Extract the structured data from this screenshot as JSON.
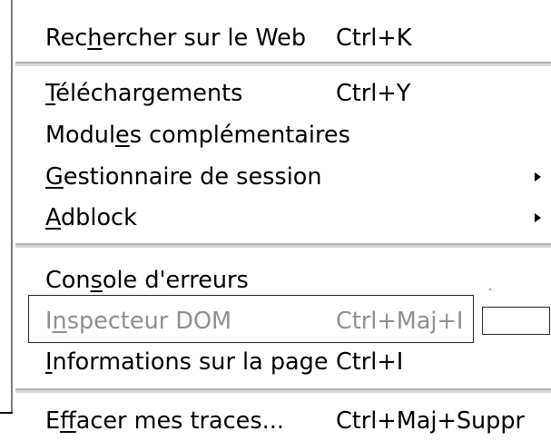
{
  "colors": {
    "background": "#ffffff",
    "text": "#000000",
    "disabled_text": "#8f8f8f",
    "separator": "#d6d6d6",
    "border": "#7a7a7a"
  },
  "menu": {
    "groups": [
      {
        "items": [
          {
            "label": "Rechercher sur le Web",
            "accesskey": "h",
            "shortcut": "Ctrl+K"
          }
        ]
      },
      {
        "items": [
          {
            "label": "Téléchargements",
            "accesskey": "T",
            "shortcut": "Ctrl+Y"
          },
          {
            "label": "Modules complémentaires",
            "accesskey": "e"
          },
          {
            "label": "Gestionnaire de session",
            "accesskey": "G",
            "submenu_icon": "submenu-arrow-icon"
          },
          {
            "label": "Adblock",
            "accesskey": "A",
            "submenu_icon": "submenu-arrow-icon"
          }
        ]
      },
      {
        "items": [
          {
            "label": "Console d'erreurs",
            "accesskey": "s"
          },
          {
            "label": "Inspecteur DOM",
            "accesskey": "n",
            "shortcut": "Ctrl+Maj+I",
            "disabled": true
          },
          {
            "label": "Informations sur la page",
            "accesskey": "I",
            "shortcut": "Ctrl+I"
          }
        ]
      },
      {
        "items": [
          {
            "label": "Effacer mes traces...",
            "accesskey": "f",
            "shortcut": "Ctrl+Maj+Suppr"
          }
        ]
      }
    ]
  }
}
